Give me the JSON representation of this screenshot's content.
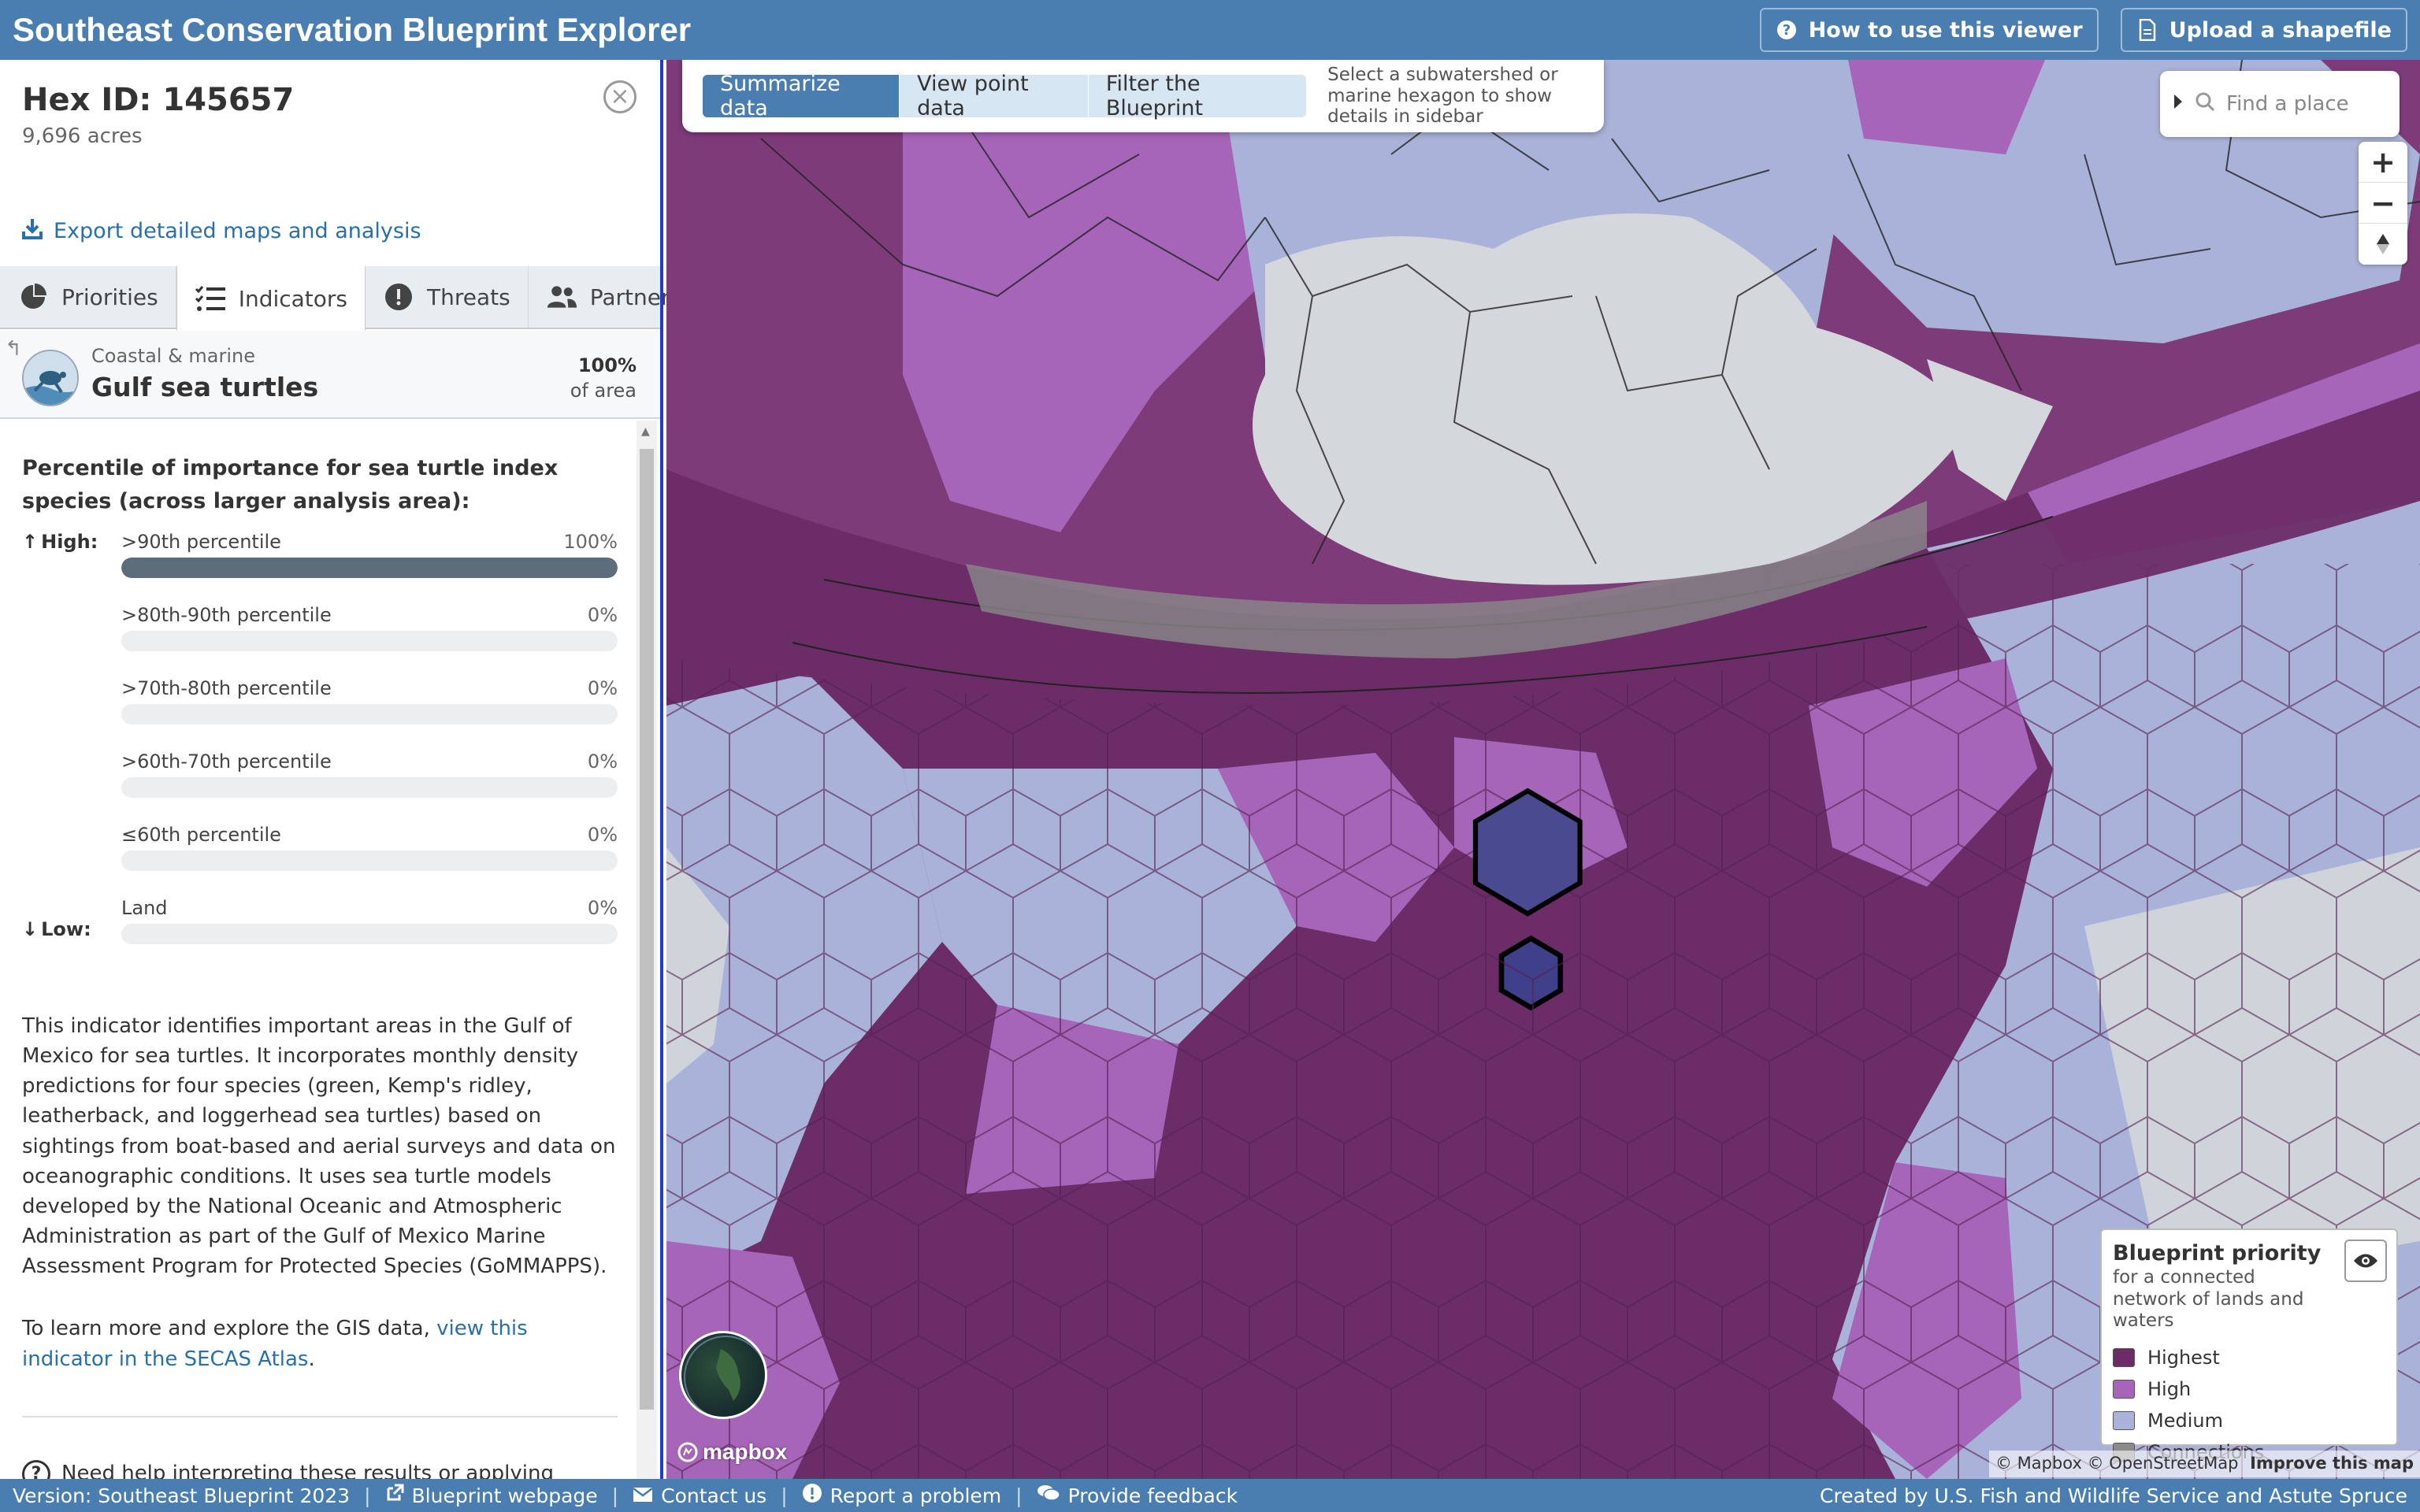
{
  "header": {
    "title": "Southeast  Conservation Blueprint Explorer",
    "help_button": "How to use this viewer",
    "upload_button": "Upload a shapefile"
  },
  "sidebar": {
    "hex_title": "Hex ID: 145657",
    "acres": "9,696 acres",
    "export_link": "Export detailed maps and analysis",
    "tabs": [
      {
        "label": "Priorities",
        "icon": "pie-chart-icon"
      },
      {
        "label": "Indicators",
        "icon": "list-check-icon"
      },
      {
        "label": "Threats",
        "icon": "alert-icon"
      },
      {
        "label": "Partners",
        "icon": "users-icon"
      }
    ],
    "indicator": {
      "category": "Coastal & marine",
      "name": "Gulf sea turtles",
      "percent": "100%",
      "percent_label": "of area"
    },
    "percentile_title": "Percentile of importance for sea turtle index species (across larger analysis area):",
    "high_label": "High:",
    "low_label": "Low:",
    "bars": [
      {
        "label": ">90th percentile",
        "value_text": "100%",
        "value": 100
      },
      {
        "label": ">80th-90th percentile",
        "value_text": "0%",
        "value": 0
      },
      {
        "label": ">70th-80th percentile",
        "value_text": "0%",
        "value": 0
      },
      {
        "label": ">60th-70th percentile",
        "value_text": "0%",
        "value": 0
      },
      {
        "label": "≤60th percentile",
        "value_text": "0%",
        "value": 0
      },
      {
        "label": "Land",
        "value_text": "0%",
        "value": 0
      }
    ],
    "description": "This indicator identifies important areas in the Gulf of Mexico for sea turtles. It incorporates monthly density predictions for four species (green, Kemp's ridley, leatherback, and loggerhead sea turtles) based on sightings from boat-based and aerial surveys and data on oceanographic conditions. It uses sea turtle models developed by the National Oceanic and Atmospheric Administration as part of the Gulf of Mexico Marine Assessment Program for Protected Species (GoMMAPPS).",
    "learn_prefix": "To learn more and explore the GIS data, ",
    "learn_link": "view this indicator in the SECAS Atlas",
    "learn_suffix": ".",
    "help_text": "Need help interpreting these results or applying Blueprint priorities to your particular project or decision? Please contact..."
  },
  "map": {
    "toolbar": {
      "summarize": "Summarize data",
      "point": "View point data",
      "filter": "Filter the Blueprint",
      "hint": "Select a subwatershed or marine hexagon to show details in sidebar"
    },
    "search_placeholder": "Find a place",
    "legend": {
      "title": "Blueprint priority",
      "subtitle": "for a connected network of lands and waters",
      "items": [
        {
          "label": "Highest",
          "color": "#6b2c68"
        },
        {
          "label": "High",
          "color": "#a665b8"
        },
        {
          "label": "Medium",
          "color": "#a9b2d8"
        },
        {
          "label": "Connections",
          "color": "#8a8a8a"
        }
      ]
    },
    "mapbox_logo": "mapbox",
    "attribution": "© Mapbox © OpenStreetMap",
    "improve": "Improve this map"
  },
  "footer": {
    "version": "Version: Southeast Blueprint 2023",
    "webpage": "Blueprint webpage",
    "contact": "Contact us",
    "report": "Report a problem",
    "feedback": "Provide feedback",
    "credit": "Created by U.S. Fish and Wildlife Service and Astute Spruce"
  }
}
